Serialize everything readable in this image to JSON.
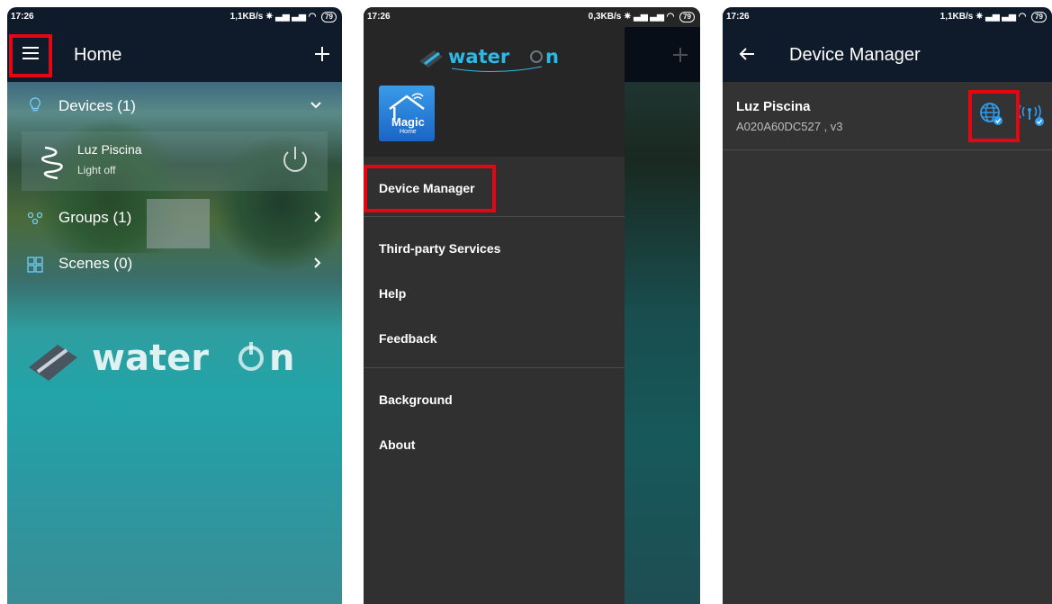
{
  "status_bar": {
    "time": "17:26",
    "screen1_speed": "1,1KB/s",
    "screen2_speed": "0,3KB/s",
    "screen3_speed": "1,1KB/s",
    "battery": "79"
  },
  "home": {
    "title": "Home",
    "devices_label": "Devices (1)",
    "device_name": "Luz Piscina",
    "device_status": "Light off",
    "groups_label": "Groups (1)",
    "scenes_label": "Scenes (0)"
  },
  "drawer": {
    "brand": "water on",
    "app_badge_line1": "Magic",
    "app_badge_line2": "Home",
    "menu": [
      {
        "label": "Device Manager"
      },
      {
        "label": "Third-party Services"
      },
      {
        "label": "Help"
      },
      {
        "label": "Feedback"
      },
      {
        "label": "Background"
      },
      {
        "label": "About"
      }
    ]
  },
  "device_manager": {
    "title": "Device Manager",
    "device_name": "Luz Piscina",
    "device_id": "A020A60DC527 , v3"
  },
  "colors": {
    "appbar": "#0f1a2b",
    "highlight": "#e30613",
    "accent": "#2e9cf0",
    "drawer": "#303030"
  }
}
